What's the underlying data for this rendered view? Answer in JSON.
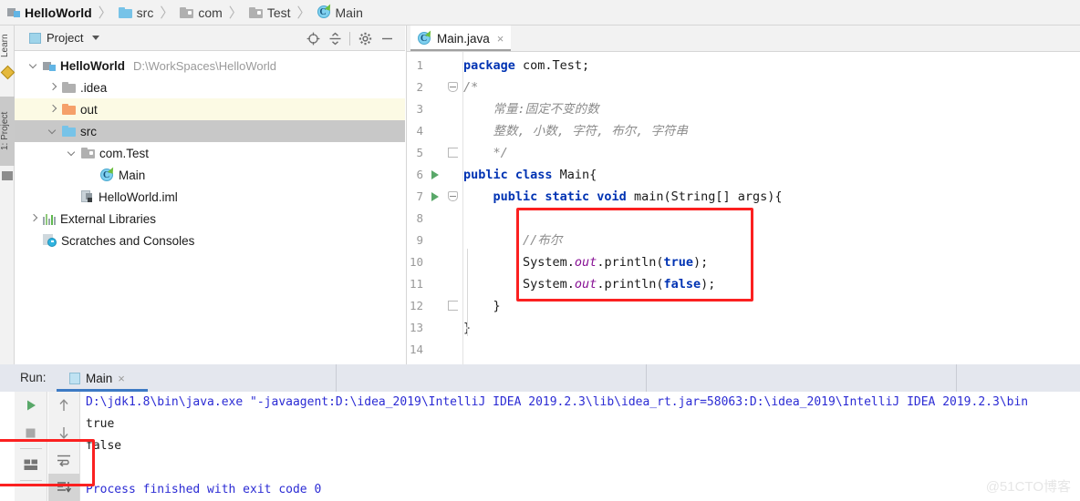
{
  "breadcrumb": {
    "items": [
      {
        "label": "HelloWorld",
        "icon": "module-icon",
        "bold": true
      },
      {
        "label": "src",
        "icon": "folder-blue-icon",
        "bold": false
      },
      {
        "label": "com",
        "icon": "package-icon",
        "bold": false
      },
      {
        "label": "Test",
        "icon": "package-icon",
        "bold": false
      },
      {
        "label": "Main",
        "icon": "java-class-icon",
        "bold": false
      }
    ],
    "separator": "〉"
  },
  "left_strip": {
    "tabs": [
      {
        "label": "Learn"
      },
      {
        "label": "1: Project"
      }
    ]
  },
  "project_panel": {
    "title": "Project",
    "actions": [
      {
        "name": "locate-icon",
        "tooltip": "Select Opened File"
      },
      {
        "name": "collapse-all-icon",
        "tooltip": "Collapse All"
      },
      {
        "name": "gear-icon",
        "tooltip": "Settings"
      },
      {
        "name": "minimize-icon",
        "tooltip": "Hide"
      }
    ],
    "tree": [
      {
        "label": "HelloWorld",
        "path": "D:\\WorkSpaces\\HelloWorld",
        "icon": "module-icon",
        "arrow": "down",
        "indent": 0,
        "bold": true,
        "highlight": "none"
      },
      {
        "label": ".idea",
        "path": "",
        "icon": "folder-gray-icon",
        "arrow": "right",
        "indent": 1,
        "bold": false,
        "highlight": "none"
      },
      {
        "label": "out",
        "path": "",
        "icon": "folder-orange-icon",
        "arrow": "right",
        "indent": 1,
        "bold": false,
        "highlight": "yellow"
      },
      {
        "label": "src",
        "path": "",
        "icon": "folder-blue-icon",
        "arrow": "down",
        "indent": 1,
        "bold": false,
        "highlight": "gray"
      },
      {
        "label": "com.Test",
        "path": "",
        "icon": "package-icon",
        "arrow": "down",
        "indent": 2,
        "bold": false,
        "highlight": "none"
      },
      {
        "label": "Main",
        "path": "",
        "icon": "java-class-icon",
        "arrow": "none",
        "indent": 3,
        "bold": false,
        "highlight": "none"
      },
      {
        "label": "HelloWorld.iml",
        "path": "",
        "icon": "iml-file-icon",
        "arrow": "none",
        "indent": 2,
        "bold": false,
        "highlight": "none"
      },
      {
        "label": "External Libraries",
        "path": "",
        "icon": "libraries-icon",
        "arrow": "right",
        "indent": 0,
        "bold": false,
        "highlight": "none"
      },
      {
        "label": "Scratches and Consoles",
        "path": "",
        "icon": "scratches-icon",
        "arrow": "none",
        "indent": 0,
        "bold": false,
        "highlight": "none"
      }
    ]
  },
  "editor": {
    "tab": {
      "label": "Main.java",
      "icon": "java-class-icon",
      "close": "×"
    },
    "lines": [
      {
        "num": "1",
        "marker": "none",
        "fold": "none",
        "segments": [
          {
            "t": "package",
            "c": "kw"
          },
          {
            "t": " com.Test;",
            "c": "plain"
          }
        ],
        "indent": 0
      },
      {
        "num": "2",
        "marker": "none",
        "fold": "open",
        "segments": [
          {
            "t": "/*",
            "c": "cmt"
          }
        ],
        "indent": 0
      },
      {
        "num": "3",
        "marker": "none",
        "fold": "none",
        "segments": [
          {
            "t": "    常量:固定不变的数",
            "c": "cmt"
          }
        ],
        "indent": 0
      },
      {
        "num": "4",
        "marker": "none",
        "fold": "none",
        "segments": [
          {
            "t": "    整数, 小数, 字符, 布尔, 字符串",
            "c": "cmt"
          }
        ],
        "indent": 0
      },
      {
        "num": "5",
        "marker": "none",
        "fold": "end",
        "segments": [
          {
            "t": "    */",
            "c": "cmt"
          }
        ],
        "indent": 0
      },
      {
        "num": "6",
        "marker": "run",
        "fold": "none",
        "segments": [
          {
            "t": "public class",
            "c": "kw"
          },
          {
            "t": " Main{",
            "c": "plain"
          }
        ],
        "indent": 0
      },
      {
        "num": "7",
        "marker": "run",
        "fold": "open",
        "segments": [
          {
            "t": "    public static void",
            "c": "kw"
          },
          {
            "t": " main(String[] args){",
            "c": "plain"
          }
        ],
        "indent": 0
      },
      {
        "num": "8",
        "marker": "none",
        "fold": "none",
        "segments": [],
        "indent": 0
      },
      {
        "num": "9",
        "marker": "none",
        "fold": "none",
        "segments": [
          {
            "t": "        //布尔",
            "c": "cmt"
          }
        ],
        "indent": 0
      },
      {
        "num": "10",
        "marker": "none",
        "fold": "none",
        "segments": [
          {
            "t": "        System.",
            "c": "plain"
          },
          {
            "t": "out",
            "c": "fld"
          },
          {
            "t": ".println(",
            "c": "plain"
          },
          {
            "t": "true",
            "c": "kw"
          },
          {
            "t": ");",
            "c": "plain"
          }
        ],
        "indent": 0
      },
      {
        "num": "11",
        "marker": "none",
        "fold": "none",
        "segments": [
          {
            "t": "        System.",
            "c": "plain"
          },
          {
            "t": "out",
            "c": "fld"
          },
          {
            "t": ".println(",
            "c": "plain"
          },
          {
            "t": "false",
            "c": "kw"
          },
          {
            "t": ");",
            "c": "plain"
          }
        ],
        "indent": 0
      },
      {
        "num": "12",
        "marker": "none",
        "fold": "end",
        "segments": [
          {
            "t": "    }",
            "c": "plain"
          }
        ],
        "indent": 0
      },
      {
        "num": "13",
        "marker": "none",
        "fold": "none",
        "segments": [
          {
            "t": "}",
            "c": "plain"
          }
        ],
        "indent": 0
      },
      {
        "num": "14",
        "marker": "none",
        "fold": "none",
        "segments": [],
        "indent": 0
      }
    ],
    "annotation": {
      "name": "red-highlight-box-editor"
    }
  },
  "run_panel": {
    "label": "Run:",
    "tab": {
      "label": "Main",
      "icon": "run-config-icon",
      "close": "×"
    },
    "tools_left": [
      {
        "name": "run-icon"
      },
      {
        "name": "stop-icon"
      },
      {
        "name": "layout-icon"
      }
    ],
    "tools_right": [
      {
        "name": "arrow-up-icon"
      },
      {
        "name": "arrow-down-icon"
      },
      {
        "name": "soft-wrap-icon"
      },
      {
        "name": "scroll-to-end-icon",
        "selected": true
      }
    ],
    "console": [
      {
        "text": "D:\\jdk1.8\\bin\\java.exe \"-javaagent:D:\\idea_2019\\IntelliJ IDEA 2019.2.3\\lib\\idea_rt.jar=58063:D:\\idea_2019\\IntelliJ IDEA 2019.2.3\\bin",
        "color": "blue"
      },
      {
        "text": "true",
        "color": "black"
      },
      {
        "text": "false",
        "color": "black"
      },
      {
        "text": "",
        "color": "black"
      },
      {
        "text": "Process finished with exit code 0",
        "color": "blue"
      }
    ],
    "annotation": {
      "name": "red-highlight-box-console"
    }
  },
  "watermark": "@51CTO博客",
  "colors": {
    "accent_blue": "#3d7ac4",
    "annotation_red": "#fb2020",
    "keyword": "#0033b3",
    "comment": "#8c8c8c",
    "field": "#871094",
    "console_blue": "#2b2bd4",
    "selection_gray": "#c8c8c8",
    "highlight_yellow": "#fcfae4"
  }
}
